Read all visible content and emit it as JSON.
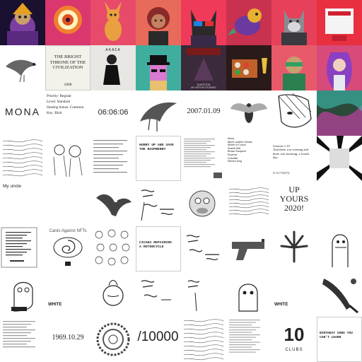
{
  "grid": {
    "tiles": [
      {
        "label": "Wizard avatar art",
        "bg": "#1a1030"
      },
      {
        "label": "Psychedelic portal art",
        "bg": "#d9376e"
      },
      {
        "label": "Kangaroo character art",
        "bg": "#e84a6a"
      },
      {
        "label": "Curly hair woman art",
        "bg": "#e86a5a"
      },
      {
        "label": "Cat with 3D glasses art",
        "bg": "#f03a5a"
      },
      {
        "label": "Dragon creature art",
        "bg": "#c8324e"
      },
      {
        "label": "Wolf character art",
        "bg": "#e6405a"
      },
      {
        "label": "Red box art",
        "bg": "#e83040"
      },
      {
        "label": "Bird sketch",
        "bg": "#ffffff"
      },
      {
        "label": "Book cover",
        "bg": "#f4f1ea",
        "title": "THE BRIGHT\nTHRONE OF THE\nCIVILIZATION",
        "year": "1808"
      },
      {
        "label": "Dark figure photo",
        "bg": "#e8e6e2",
        "caption": "ΑΚΑΣΑ"
      },
      {
        "label": "Pixel punk art",
        "bg": "#3fae9f"
      },
      {
        "label": "Game cover art",
        "bg": "#3a2a3a",
        "caption": "QUESTION\nMY MYTHS STORIES"
      },
      {
        "label": "Sushi art",
        "bg": "#2a1a1a"
      },
      {
        "label": "Ninja avatar art",
        "bg": "#e85a6a"
      },
      {
        "label": "Purple hair girl art",
        "bg": "#d84a7a"
      },
      {
        "label": "MONA",
        "bg": "#ffffff",
        "text": "MONA"
      },
      {
        "label": "Traits card",
        "bg": "#ffffff",
        "lines": [
          "Priority: Regular",
          "Level: Standard",
          "Starting bonus: Common",
          "Key: Blob"
        ]
      },
      {
        "label": "Time",
        "bg": "#ffffff",
        "text": "06:06:06"
      },
      {
        "label": "Dragon wing art",
        "bg": "#ffffff"
      },
      {
        "label": "Date",
        "bg": "#ffffff",
        "text": "2007.01.09"
      },
      {
        "label": "Cicada art",
        "bg": "#ffffff"
      },
      {
        "label": "Manga face art",
        "bg": "#ffffff"
      },
      {
        "label": "Colorful abstract",
        "bg": "#2a4a3a"
      },
      {
        "label": "Wave lines",
        "bg": "#ffffff"
      },
      {
        "label": "Doodle sketch",
        "bg": "#ffffff"
      },
      {
        "label": "Text list",
        "bg": "#ffffff"
      },
      {
        "label": "Typed note",
        "bg": "#ffffff",
        "text": "HURRY UP AND SAVE\nTHE RASPBERRY"
      },
      {
        "label": "Text list 2",
        "bg": "#ffffff"
      },
      {
        "label": "Name list",
        "bg": "#ffffff",
        "lines": [
          "Mona",
          "Black Leather Grease",
          "Wheel of Colour",
          "Scarlet Mitt",
          "Brown Sculpture",
          "Reverse",
          "Chandler",
          "Silence King"
        ]
      },
      {
        "label": "Genesis",
        "bg": "#ffffff",
        "text": "Genesis 1:19\nAnd there was evening and\nthere was morning, a fourth\nday.",
        "hebrew": "בְּרֵאשִׁית א יט"
      },
      {
        "label": "Rays",
        "bg": "#ffffff"
      },
      {
        "label": "My uncle",
        "bg": "#ffffff",
        "text": "My uncle"
      },
      {
        "label": "Blank",
        "bg": "#ffffff"
      },
      {
        "label": "Eagle sketch",
        "bg": "#ffffff"
      },
      {
        "label": "Handwriting",
        "bg": "#ffffff"
      },
      {
        "label": "Ape sketch",
        "bg": "#ffffff"
      },
      {
        "label": "Wave lines 2",
        "bg": "#ffffff"
      },
      {
        "label": "Up yours",
        "bg": "#ffffff",
        "text": "UP\nYOURS\n2020!"
      },
      {
        "label": "Blank 2",
        "bg": "#ffffff"
      },
      {
        "label": "Receipt",
        "bg": "#ffffff"
      },
      {
        "label": "Spiral cards",
        "bg": "#ffffff",
        "caption": "Cards Against NFTs"
      },
      {
        "label": "Crowd doodle",
        "bg": "#ffffff"
      },
      {
        "label": "Typed note 2",
        "bg": "#ffffff",
        "text": "CICADA REPAIRING\nA MOTORCYCLE"
      },
      {
        "label": "Handwriting 2",
        "bg": "#ffffff"
      },
      {
        "label": "Pistol sketch",
        "bg": "#ffffff"
      },
      {
        "label": "Leaf sketch",
        "bg": "#ffffff"
      },
      {
        "label": "Creature sketch",
        "bg": "#ffffff"
      },
      {
        "label": "Character doodle",
        "bg": "#ffffff"
      },
      {
        "label": "White badge",
        "bg": "#ffffff",
        "text": "WHITE"
      },
      {
        "label": "Onion doodle",
        "bg": "#ffffff"
      },
      {
        "label": "Handwriting 3",
        "bg": "#ffffff"
      },
      {
        "label": "Handwriting 4",
        "bg": "#ffffff"
      },
      {
        "label": "Head doodle",
        "bg": "#ffffff"
      },
      {
        "label": "White badge 2",
        "bg": "#ffffff",
        "text": "WHITE"
      },
      {
        "label": "Knife sketch",
        "bg": "#ffffff"
      },
      {
        "label": "Text note",
        "bg": "#ffffff"
      },
      {
        "label": "Date 2",
        "bg": "#ffffff",
        "text": "1969.10.29"
      },
      {
        "label": "Circle scribble",
        "bg": "#ffffff"
      },
      {
        "label": "Count",
        "bg": "#ffffff",
        "text": "/10000"
      },
      {
        "label": "Wave lines 3",
        "bg": "#ffffff"
      },
      {
        "label": "Text list 3",
        "bg": "#ffffff"
      },
      {
        "label": "Clubs",
        "bg": "#ffffff",
        "text": "10",
        "sub": "CLUBS"
      },
      {
        "label": "Typed note 3",
        "bg": "#ffffff",
        "text": "BIRTHDAY SONG YOU\nCAN'T LEARN"
      }
    ]
  },
  "colors": {
    "ink": "#222222",
    "muted": "#777777"
  }
}
